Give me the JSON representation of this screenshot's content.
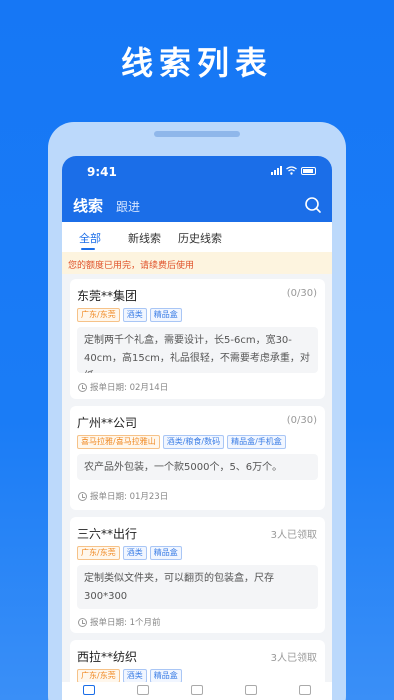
{
  "banner": {
    "title": "线索列表"
  },
  "status_bar": {
    "time": "9:41"
  },
  "nav": {
    "active_tab": "线索",
    "other_tab": "跟进",
    "search_icon": "search-icon"
  },
  "subtabs": [
    {
      "label": "全部",
      "active": true
    },
    {
      "label": "新线索",
      "active": false
    },
    {
      "label": "历史线索",
      "active": false
    }
  ],
  "notice": "您的额度已用完，请续费后使用",
  "cards": [
    {
      "title": "东莞**集团",
      "count": "(0/30)",
      "tags": [
        {
          "text": "广东/东莞",
          "color": "orange"
        },
        {
          "text": "酒类",
          "color": "blue"
        },
        {
          "text": "精品盒",
          "color": "blue"
        }
      ],
      "description": "定制两千个礼盒，需要设计，长5-6cm，宽30-40cm，高15cm，礼品很轻，不需要考虑承重，对纸...",
      "date": "报单日期: 02月14日"
    },
    {
      "title": "广州**公司",
      "count": "(0/30)",
      "tags": [
        {
          "text": "喜马拉雅/喜马拉雅山",
          "color": "orange"
        },
        {
          "text": "酒类/粮食/数码",
          "color": "blue"
        },
        {
          "text": "精品盒/手机盒",
          "color": "blue"
        }
      ],
      "description": "农产品外包装，一个款5000个，5、6万个。",
      "date": "报单日期: 01月23日"
    },
    {
      "title": "三六**出行",
      "count": "3人已领取",
      "tags": [
        {
          "text": "广东/东莞",
          "color": "orange"
        },
        {
          "text": "酒类",
          "color": "blue"
        },
        {
          "text": "精品盒",
          "color": "blue"
        }
      ],
      "description": "定制类似文件夹，可以翻页的包装盒，尺存300*300",
      "date": "报单日期: 1个月前"
    },
    {
      "title": "西拉**纺织",
      "count": "3人已领取",
      "tags": [
        {
          "text": "广东/东莞",
          "color": "orange"
        },
        {
          "text": "酒类",
          "color": "blue"
        },
        {
          "text": "精品盒",
          "color": "blue"
        }
      ],
      "description": "",
      "date": ""
    }
  ],
  "colors": {
    "primary": "#1b6ee8",
    "notice_text": "#e0522b",
    "tag_orange": "#f08a24",
    "tag_blue": "#3d7fe6"
  }
}
